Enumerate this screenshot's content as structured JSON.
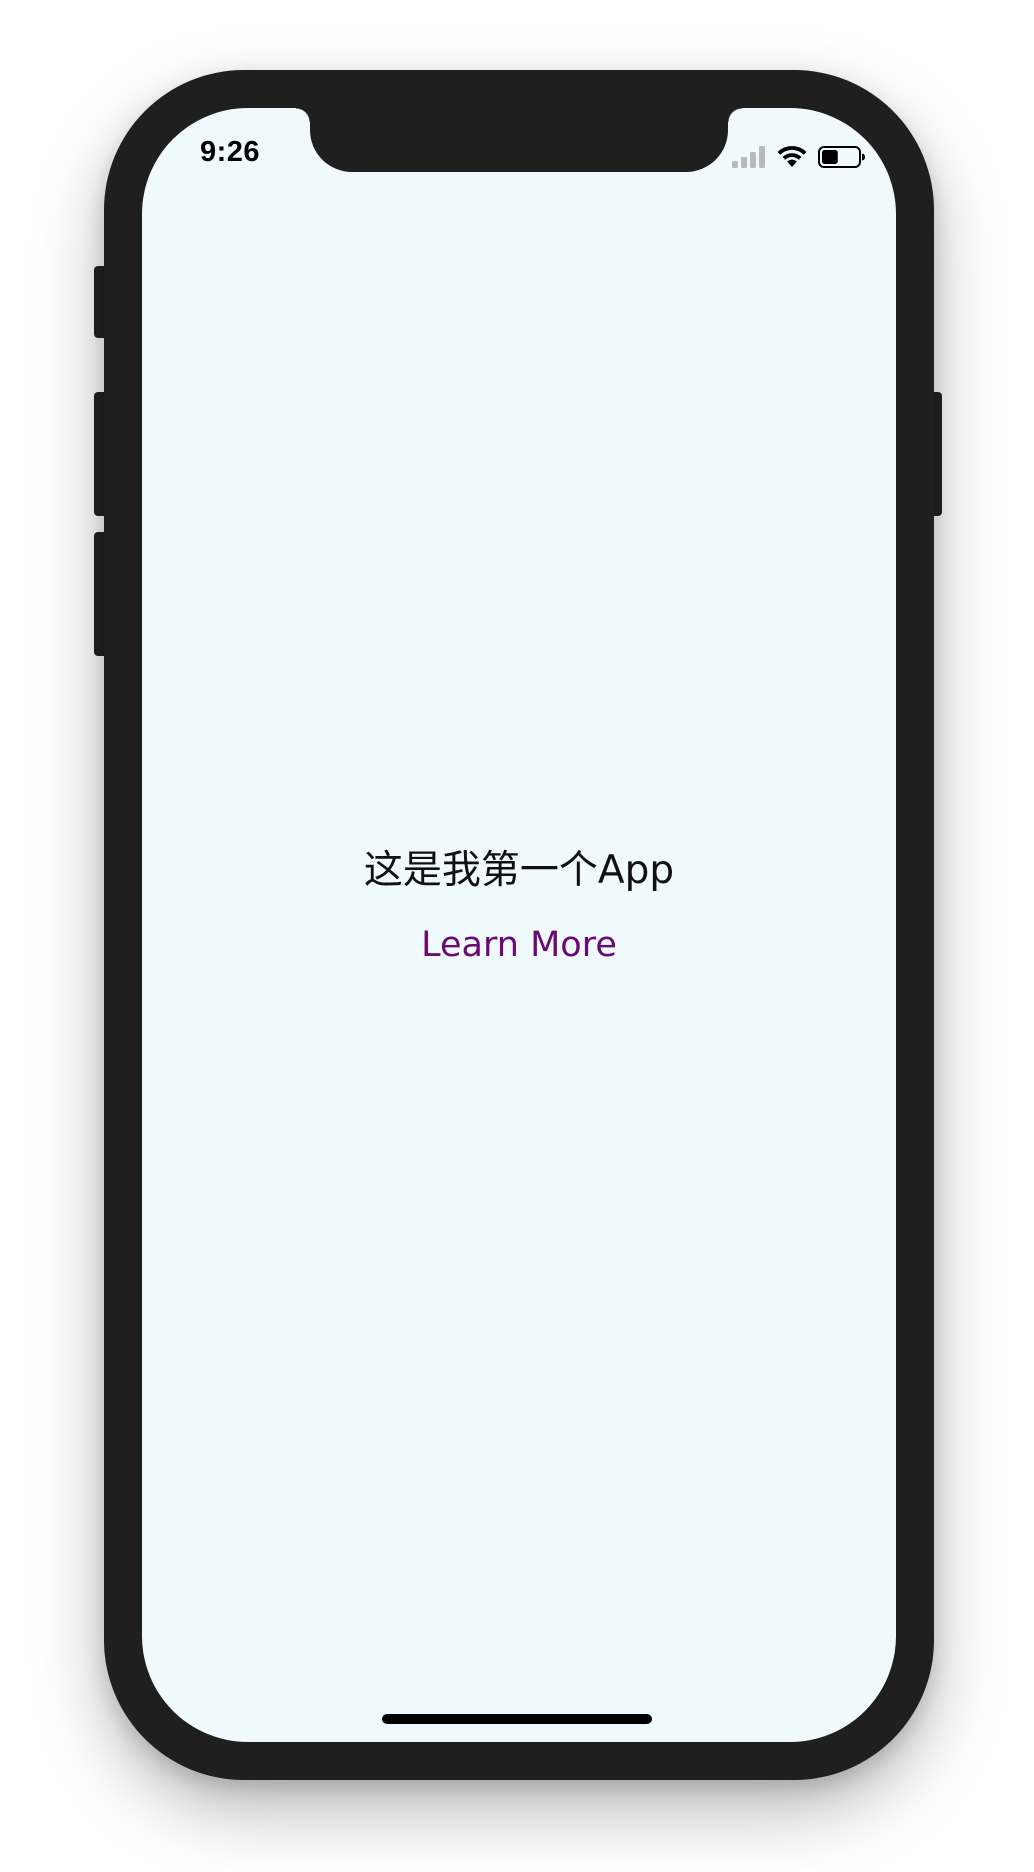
{
  "status_bar": {
    "time": "9:26",
    "signal_icon": "cellular-signal-icon",
    "wifi_icon": "wifi-icon",
    "battery_icon": "battery-icon",
    "battery_level": 0.45
  },
  "main": {
    "title": "这是我第一个App",
    "link_label": "Learn More"
  },
  "colors": {
    "screen_background": "#f0f9fc",
    "device_frame": "#1f1f1f",
    "title_text": "#111111",
    "link": "#6b0a73"
  }
}
